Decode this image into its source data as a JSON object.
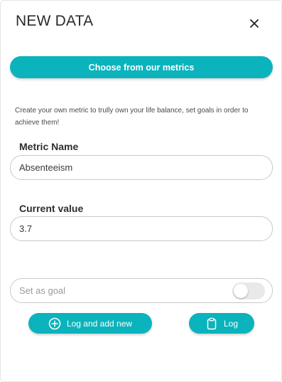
{
  "header": {
    "title": "NEW DATA",
    "close_icon": "close-icon"
  },
  "metrics_button": {
    "label": "Choose from our metrics"
  },
  "description": "Create your own metric to trully own your life balance, set goals in order to achieve them!",
  "metric_name": {
    "label": "Metric Name",
    "value": "Absenteeism"
  },
  "current_value": {
    "label": "Current value",
    "value": "3.7"
  },
  "goal": {
    "label": "Set as goal",
    "enabled": false
  },
  "actions": {
    "log_and_add_new": {
      "label": "Log and add new",
      "icon": "plus-circle-icon"
    },
    "log": {
      "label": "Log",
      "icon": "clipboard-icon"
    }
  },
  "colors": {
    "accent": "#0bb3bc",
    "field_border": "#c9c9c9",
    "toggle_off": "#e9e9e9"
  }
}
